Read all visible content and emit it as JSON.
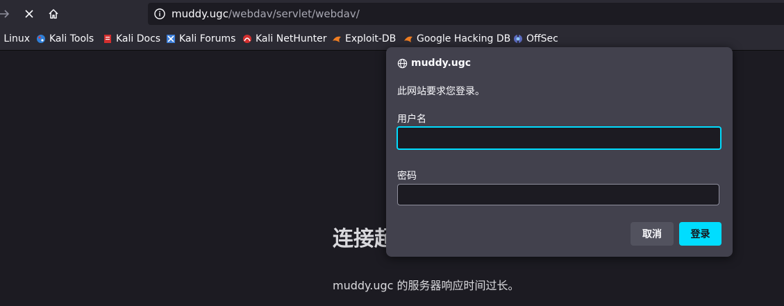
{
  "toolbar": {
    "url_host": "muddy.ugc",
    "url_path": "/webdav/servlet/webdav/"
  },
  "bookmarks": [
    {
      "label": "i Linux",
      "icon": "kali-linux-icon"
    },
    {
      "label": "Kali Tools",
      "icon": "kali-tools-icon"
    },
    {
      "label": "Kali Docs",
      "icon": "kali-docs-icon"
    },
    {
      "label": "Kali Forums",
      "icon": "kali-forums-icon"
    },
    {
      "label": "Kali NetHunter",
      "icon": "kali-nethunter-icon"
    },
    {
      "label": "Exploit-DB",
      "icon": "exploit-db-icon"
    },
    {
      "label": "Google Hacking DB",
      "icon": "google-hacking-db-icon"
    },
    {
      "label": "OffSec",
      "icon": "offsec-icon"
    }
  ],
  "error_page": {
    "title": "连接超",
    "message": "muddy.ugc 的服务器响应时间过长。"
  },
  "auth_dialog": {
    "host": "muddy.ugc",
    "message": "此网站要求您登录。",
    "username_label": "用户名",
    "username_value": "",
    "password_label": "密码",
    "password_value": "",
    "cancel_label": "取消",
    "login_label": "登录"
  },
  "colors": {
    "accent": "#00ddff",
    "dialog_bg": "#42414d",
    "page_bg": "#1c1b22",
    "toolbar_bg": "#2b2a33"
  }
}
